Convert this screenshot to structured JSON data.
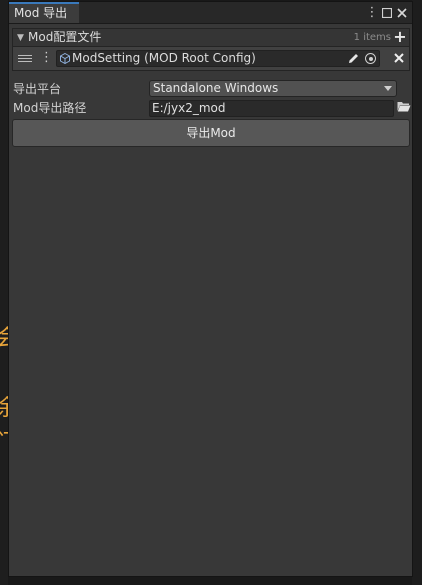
{
  "window": {
    "tab_title": "Mod 导出",
    "menu_icon": "kebab-menu-icon",
    "maximize_icon": "maximize-icon",
    "close_icon": "close-icon"
  },
  "background": {
    "glyphs": [
      "会",
      "余",
      "门"
    ],
    "glyph_color": "#e7a43a"
  },
  "mod_config_list": {
    "title": "Mod配置文件",
    "count_label": "1 items",
    "add_icon": "plus-icon",
    "items": [
      {
        "value": "ModSetting (MOD Root Config)",
        "icon": "scriptable-object-icon"
      }
    ]
  },
  "export_platform": {
    "label": "导出平台",
    "value": "Standalone Windows"
  },
  "export_path": {
    "label": "Mod导出路径",
    "value": "E:/jyx2_mod",
    "browse_icon": "folder-open-icon"
  },
  "export_button": {
    "label": "导出Mod"
  },
  "colors": {
    "window_bg": "#383838",
    "tab_accent": "#3a79bb",
    "button_bg": "#575757"
  }
}
